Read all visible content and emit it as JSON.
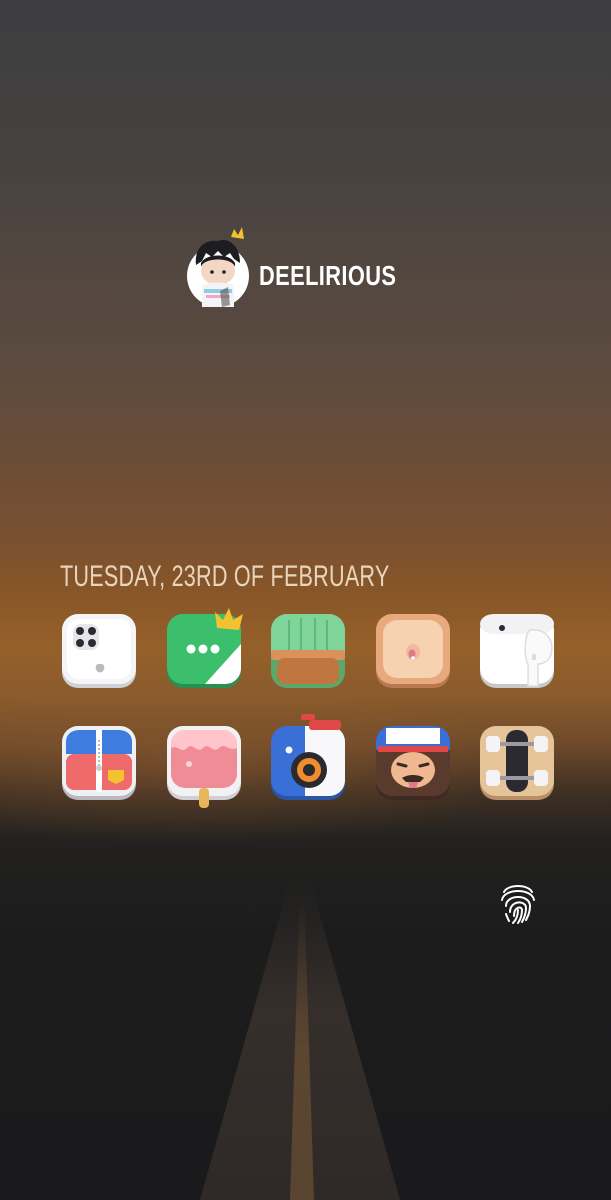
{
  "header": {
    "brand_name": "DEELIRIOUS",
    "avatar_icon": "character-avatar-icon"
  },
  "date_text": "TUESDAY, 23RD OF FEBRUARY",
  "apps": [
    {
      "icon": "phone-device-icon",
      "row": 1
    },
    {
      "icon": "messages-crown-icon",
      "row": 1
    },
    {
      "icon": "cactus-pot-icon",
      "row": 1
    },
    {
      "icon": "bowl-icon",
      "row": 1
    },
    {
      "icon": "earbuds-case-icon",
      "row": 1
    },
    {
      "icon": "backpack-zipper-icon",
      "row": 2
    },
    {
      "icon": "popsicle-icon",
      "row": 2
    },
    {
      "icon": "camera-app-icon",
      "row": 2
    },
    {
      "icon": "cap-character-icon",
      "row": 2
    },
    {
      "icon": "skateboard-icon",
      "row": 2
    }
  ],
  "fingerprint_icon": "fingerprint-icon",
  "colors": {
    "accent_green": "#3bb86a",
    "accent_red": "#e24b4b",
    "accent_blue": "#3a6fd8",
    "text": "#ffffff"
  }
}
